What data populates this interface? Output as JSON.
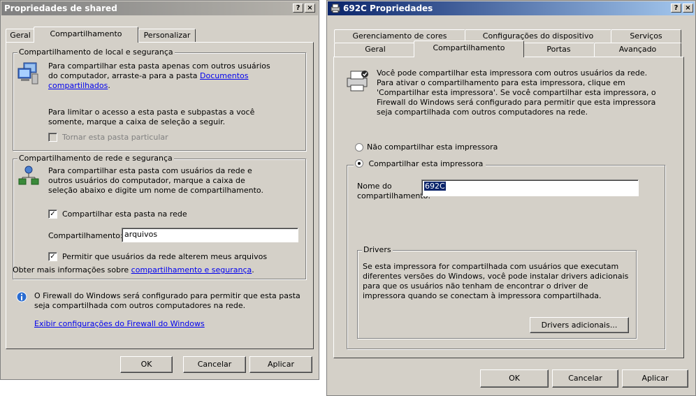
{
  "left": {
    "title": "Propriedades de shared",
    "caption_buttons": {
      "help": "?",
      "close": "×"
    },
    "tabs": [
      "Geral",
      "Compartilhamento",
      "Personalizar"
    ],
    "local_group": {
      "legend": "Compartilhamento de local e segurança",
      "text1": "Para compartilhar esta pasta apenas com outros usuários do computador, arraste-a para a pasta",
      "link": "Documentos compartilhados",
      "link_after": ".",
      "text2": "Para limitar o acesso a esta pasta e subpastas a você somente, marque a caixa de seleção a seguir.",
      "private_checkbox": "Tornar esta pasta particular"
    },
    "network_group": {
      "legend": "Compartilhamento de rede e segurança",
      "text": "Para compartilhar esta pasta com usuários da rede e outros usuários do computador, marque a caixa de seleção abaixo e digite um nome de compartilhamento.",
      "share_checkbox": "Compartilhar esta pasta na rede",
      "share_label": "Compartilhamento:",
      "share_value": "arquivos",
      "allow_checkbox": "Permitir que usuários da rede alterem meus arquivos",
      "more_info_prefix": "Obter mais informações sobre",
      "more_info_link": "compartilhamento e segurança",
      "more_info_suffix": "."
    },
    "firewall_text": "O Firewall do Windows será configurado para permitir que esta pasta seja compartilhada com outros computadores na rede.",
    "firewall_link": "Exibir configurações do Firewall do Windows",
    "buttons": {
      "ok": "OK",
      "cancel": "Cancelar",
      "apply": "Aplicar"
    }
  },
  "right": {
    "title": "692C Propriedades",
    "caption_buttons": {
      "help": "?",
      "close": "×"
    },
    "tabs_back": [
      "Gerenciamento de cores",
      "Configurações do dispositivo",
      "Serviços"
    ],
    "tabs_front": [
      "Geral",
      "Compartilhamento",
      "Portas",
      "Avançado"
    ],
    "intro": "Você pode compartilhar esta impressora com outros usuários da rede. Para ativar o compartilhamento para esta impressora, clique em 'Compartilhar esta impressora'. Se você compartilhar esta impressora, o Firewall do Windows será configurado para permitir que esta impressora seja compartilhada com outros computadores na rede.",
    "radio_no": "Não compartilhar esta impressora",
    "radio_yes": "Compartilhar esta impressora",
    "share_name_label": "Nome do compartilhamento:",
    "share_name_value": "692C",
    "drivers": {
      "legend": "Drivers",
      "text": "Se esta impressora for compartilhada com usuários que executam diferentes versões do Windows, você pode instalar drivers adicionais para que os usuários não tenham de encontrar o driver de impressora quando se conectam à impressora compartilhada.",
      "button": "Drivers adicionais..."
    },
    "buttons": {
      "ok": "OK",
      "cancel": "Cancelar",
      "apply": "Aplicar"
    }
  }
}
